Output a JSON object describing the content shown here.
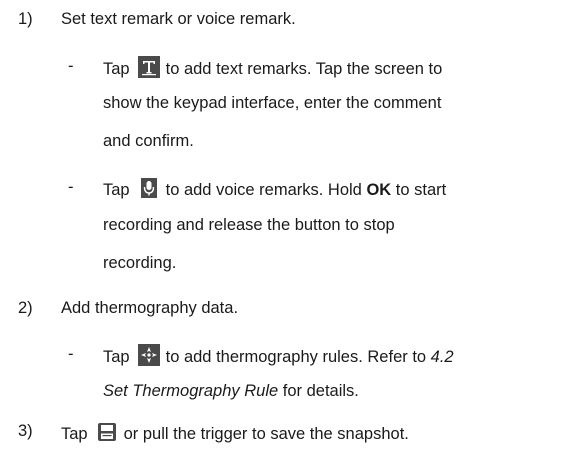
{
  "steps": [
    {
      "number": "1)",
      "text": "Set text remark or voice remark.",
      "sub": [
        {
          "bullet": "-",
          "tap": "Tap",
          "icon": "text-icon",
          "l1_rest": "to add text remarks. Tap the screen to",
          "l2": "show the keypad interface, enter the comment",
          "l3": "and confirm."
        },
        {
          "bullet": "-",
          "tap": "Tap",
          "icon": "microphone-icon",
          "l1_pre": "to add voice remarks. Hold ",
          "l1_bold": "OK",
          "l1_post": " to start",
          "l2": "recording and release the button to stop",
          "l3": "recording."
        }
      ]
    },
    {
      "number": "2)",
      "text": "Add thermography data.",
      "sub": [
        {
          "bullet": "-",
          "tap": "Tap",
          "icon": "crosshair-icon",
          "l1_pre": "to add thermography rules. Refer to ",
          "l1_italic": "4.2",
          "l2_italic": "Set Thermography Rule",
          "l2_post": " for details."
        }
      ]
    },
    {
      "number": "3)",
      "tap": "Tap",
      "icon": "save-icon",
      "rest": "or pull the trigger to save the snapshot."
    }
  ]
}
